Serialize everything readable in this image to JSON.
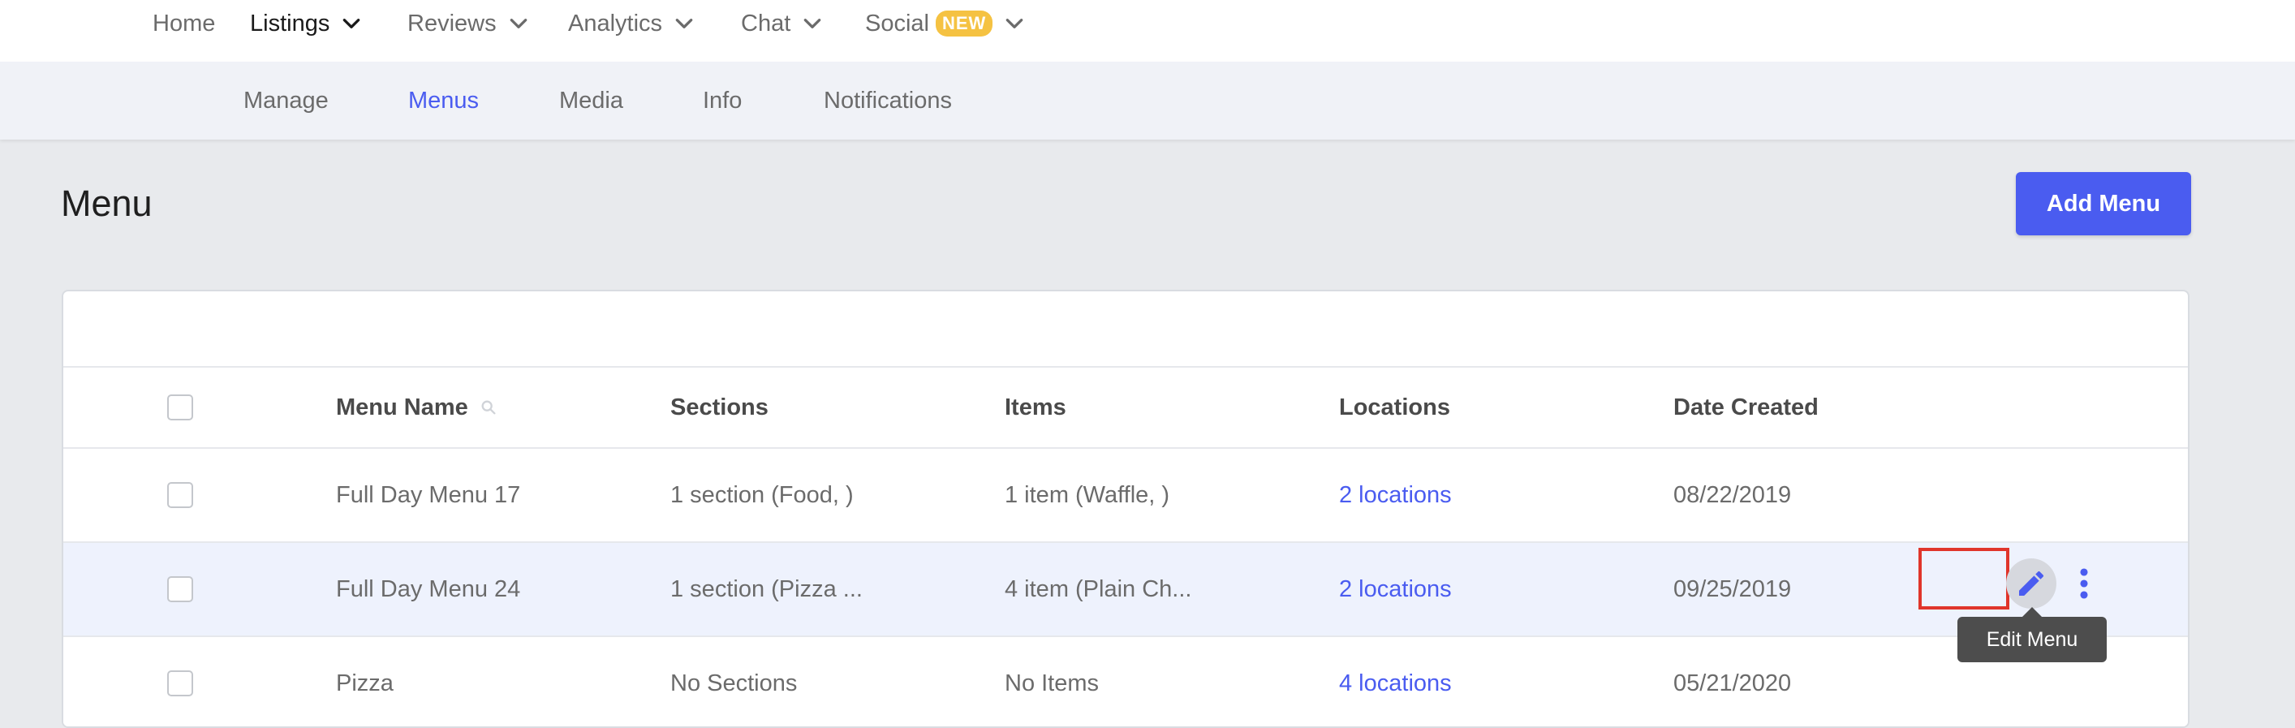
{
  "top_nav": {
    "items": [
      {
        "label": "Home",
        "active": false,
        "dropdown": false
      },
      {
        "label": "Listings",
        "active": true,
        "dropdown": true
      },
      {
        "label": "Reviews",
        "active": false,
        "dropdown": true
      },
      {
        "label": "Analytics",
        "active": false,
        "dropdown": true
      },
      {
        "label": "Chat",
        "active": false,
        "dropdown": true
      },
      {
        "label": "Social",
        "active": false,
        "dropdown": true,
        "badge": "NEW"
      }
    ]
  },
  "sub_nav": {
    "tabs": [
      {
        "label": "Manage",
        "active": false
      },
      {
        "label": "Menus",
        "active": true
      },
      {
        "label": "Media",
        "active": false
      },
      {
        "label": "Info",
        "active": false
      },
      {
        "label": "Notifications",
        "active": false
      }
    ]
  },
  "page": {
    "title": "Menu",
    "add_button_label": "Add Menu"
  },
  "table": {
    "columns": [
      "Menu Name",
      "Sections",
      "Items",
      "Locations",
      "Date Created"
    ],
    "rows": [
      {
        "name": "Full Day Menu 17",
        "sections": "1 section (Food, )",
        "items": "1 item (Waffle, )",
        "locations": "2 locations",
        "date": "08/22/2019",
        "highlighted": false
      },
      {
        "name": "Full Day Menu 24",
        "sections": "1 section (Pizza ...",
        "items": "4 item (Plain Ch...",
        "locations": "2 locations",
        "date": "09/25/2019",
        "highlighted": true
      },
      {
        "name": "Pizza",
        "sections": "No Sections",
        "items": "No Items",
        "locations": "4 locations",
        "date": "05/21/2020",
        "highlighted": false
      }
    ]
  },
  "tooltip": {
    "text": "Edit Menu"
  },
  "colors": {
    "accent": "#4a5cf0",
    "badge": "#f5c242",
    "highlight_row": "#eef2fd",
    "annotation_box": "#e0352b",
    "tooltip_bg": "#4d4d4d"
  },
  "icons": {
    "dropdown": "chevron-down-icon",
    "column_search": "search-icon",
    "edit": "pencil-icon",
    "more": "more-vertical-icon"
  }
}
